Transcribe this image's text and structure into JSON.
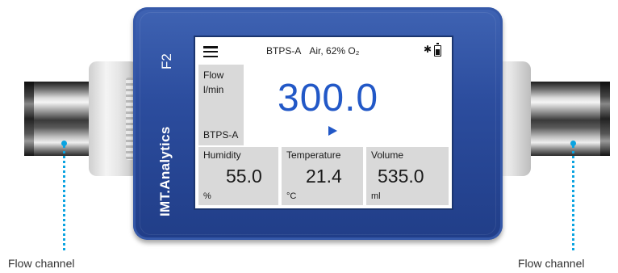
{
  "device": {
    "model": "F2",
    "brand": "IMT.Analytics"
  },
  "screen": {
    "topbar": {
      "mode": "BTPS-A",
      "gas": "Air, 62% O₂",
      "icons": [
        "menu-icon",
        "bluetooth-icon",
        "battery-icon"
      ]
    },
    "flow": {
      "label": "Flow",
      "unit": "l/min",
      "mode": "BTPS-A",
      "value": "300.0"
    },
    "humidity": {
      "label": "Humidity",
      "value": "55.0",
      "unit": "%"
    },
    "temperature": {
      "label": "Temperature",
      "value": "21.4",
      "unit": "°C"
    },
    "volume": {
      "label": "Volume",
      "value": "535.0",
      "unit": "ml"
    }
  },
  "callouts": {
    "left": "Flow channel",
    "right": "Flow channel"
  },
  "colors": {
    "body": "#2c4d9e",
    "value_blue": "#2258c7",
    "callout": "#0aa3e0",
    "cell_bg": "#d9d9d9"
  }
}
